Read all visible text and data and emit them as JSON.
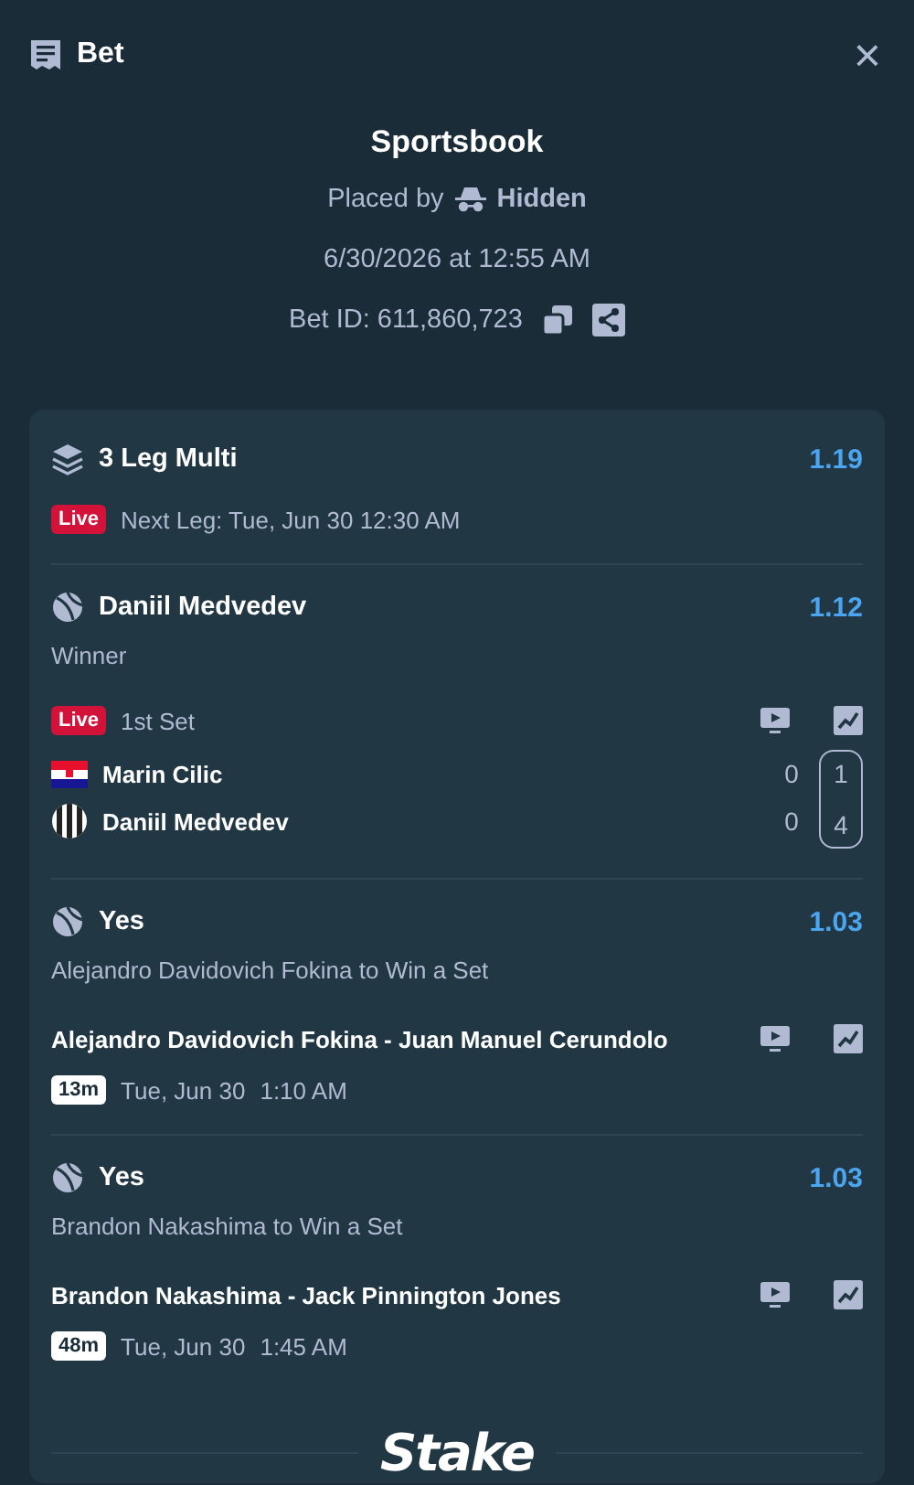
{
  "header": {
    "title": "Bet",
    "close": "×"
  },
  "summary": {
    "title": "Sportsbook",
    "placed_by_label": "Placed by",
    "placed_by_user": "Hidden",
    "date": "6/30/2026 at 12:55 AM",
    "bet_id": "Bet ID: 611,860,723"
  },
  "multi": {
    "title": "3 Leg Multi",
    "odds": "1.19",
    "badge": "Live",
    "next_leg": "Next Leg: Tue, Jun 30 12:30 AM"
  },
  "legs": [
    {
      "kind": "live",
      "selection": "Daniil Medvedev",
      "odds": "1.12",
      "market": "Winner",
      "badge": "Live",
      "period": "1st Set",
      "players": [
        {
          "name": "Marin Cilic",
          "kind": "croatia",
          "game": "0",
          "set": "1"
        },
        {
          "name": "Daniil Medvedev",
          "kind": "striped",
          "game": "0",
          "set": "4"
        }
      ]
    },
    {
      "kind": "upcoming",
      "selection": "Yes",
      "odds": "1.03",
      "market": "Alejandro Davidovich Fokina to Win a Set",
      "match": "Alejandro Davidovich Fokina - Juan Manuel Cerundolo",
      "countdown": "13m",
      "date": "Tue, Jun 30",
      "time": "1:10 AM"
    },
    {
      "kind": "upcoming",
      "selection": "Yes",
      "odds": "1.03",
      "market": "Brandon Nakashima to Win a Set",
      "match": "Brandon Nakashima - Jack Pinnington Jones",
      "countdown": "48m",
      "date": "Tue, Jun 30",
      "time": "1:45 AM"
    }
  ],
  "footer": {
    "logo": "Stake"
  }
}
